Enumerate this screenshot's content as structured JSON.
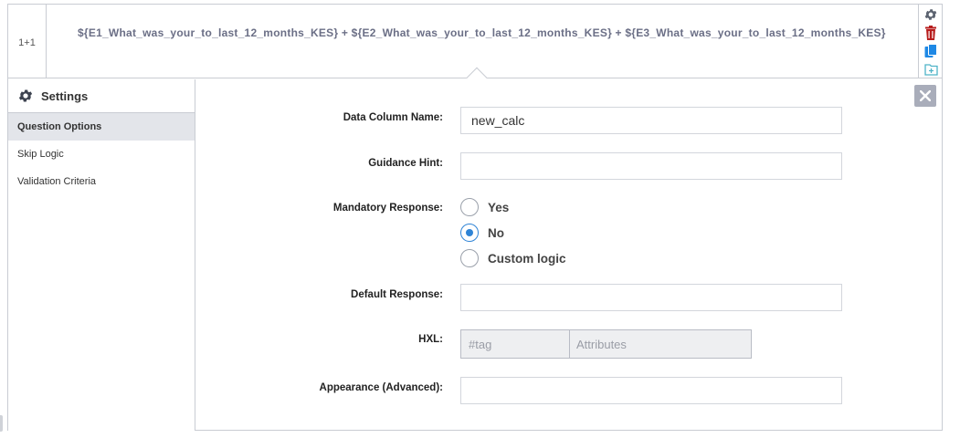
{
  "question": {
    "type_label": "1+1",
    "label": "${E1_What_was_your_to_last_12_months_KES} + ${E2_What_was_your_to_last_12_months_KES} + ${E3_What_was_your_to_last_12_months_KES}"
  },
  "actions": {
    "icons": [
      "gear-icon",
      "trash-icon",
      "duplicate-icon",
      "add-to-library-icon"
    ],
    "colors": {
      "gear": "#5c6370",
      "trash": "#b71c1c",
      "duplicate": "#1e88e5",
      "library": "#4fb3c8"
    }
  },
  "settings": {
    "title": "Settings",
    "tabs": [
      {
        "label": "Question Options",
        "active": true
      },
      {
        "label": "Skip Logic",
        "active": false
      },
      {
        "label": "Validation Criteria",
        "active": false
      }
    ]
  },
  "form": {
    "data_column_name": {
      "label": "Data Column Name:",
      "value": "new_calc"
    },
    "guidance_hint": {
      "label": "Guidance Hint:",
      "value": ""
    },
    "mandatory": {
      "label": "Mandatory Response:",
      "options": [
        {
          "label": "Yes",
          "selected": false
        },
        {
          "label": "No",
          "selected": true
        },
        {
          "label": "Custom logic",
          "selected": false
        }
      ]
    },
    "default_response": {
      "label": "Default Response:",
      "value": ""
    },
    "hxl": {
      "label": "HXL:",
      "tag_placeholder": "#tag",
      "attr_placeholder": "Attributes"
    },
    "appearance": {
      "label": "Appearance (Advanced):",
      "value": ""
    }
  },
  "accent_color": "#2f84d6"
}
